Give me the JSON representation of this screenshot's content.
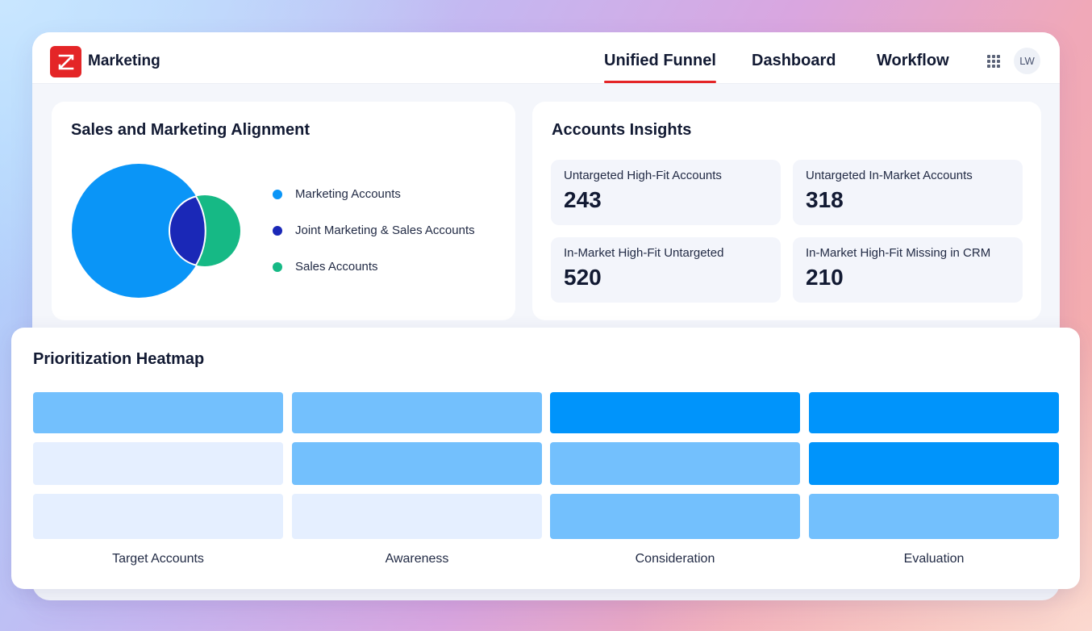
{
  "header": {
    "brand": "Marketing",
    "nav": [
      {
        "label": "Unified Funnel",
        "active": true
      },
      {
        "label": "Dashboard",
        "active": false
      },
      {
        "label": "Workflow",
        "active": false
      }
    ],
    "avatar_initials": "LW",
    "icons": [
      "apps-grid-icon"
    ]
  },
  "alignment": {
    "title": "Sales and Marketing Alignment",
    "legend": [
      {
        "label": "Marketing Accounts",
        "color": "#0a95f7"
      },
      {
        "label": "Joint Marketing & Sales Accounts",
        "color": "#1a28b7"
      },
      {
        "label": "Sales Accounts",
        "color": "#16b985"
      }
    ]
  },
  "insights": {
    "title": "Accounts Insights",
    "metrics": [
      {
        "label": "Untargeted High-Fit Accounts",
        "value": "243"
      },
      {
        "label": "Untargeted In-Market Accounts",
        "value": "318"
      },
      {
        "label": "In-Market High-Fit Untargeted",
        "value": "520"
      },
      {
        "label": "In-Market High-Fit Missing in CRM",
        "value": "210"
      }
    ]
  },
  "heatmap": {
    "title": "Prioritization Heatmap",
    "columns": [
      "Target Accounts",
      "Awareness",
      "Consideration",
      "Evaluation"
    ],
    "intensity_levels": {
      "1": "#e5efff",
      "2": "#73c0fd",
      "3": "#0094fb"
    },
    "cells": [
      [
        2,
        2,
        3,
        3
      ],
      [
        1,
        2,
        2,
        3
      ],
      [
        1,
        1,
        2,
        2
      ]
    ]
  },
  "colors": {
    "accent": "#e42527",
    "background_card": "#ffffff"
  }
}
